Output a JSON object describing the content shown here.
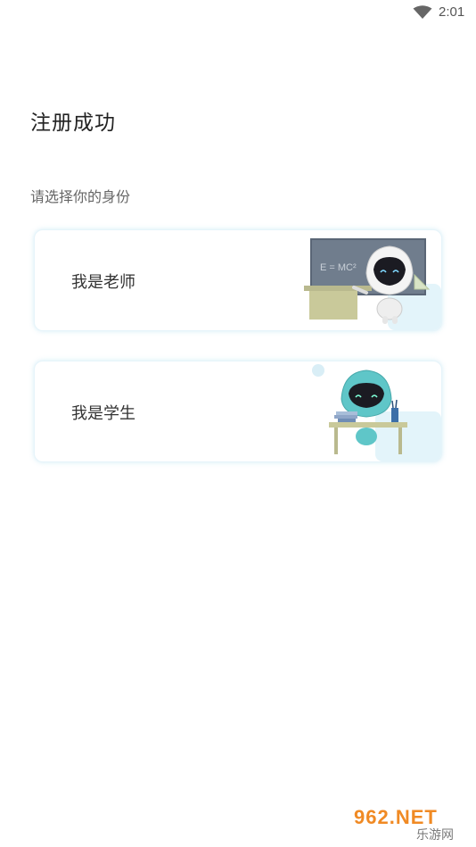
{
  "status_bar": {
    "time": "2:01",
    "wifi_icon": "wifi-icon"
  },
  "header": {
    "title": "注册成功"
  },
  "prompt": {
    "text": "请选择你的身份"
  },
  "roles": [
    {
      "label": "我是老师",
      "illustration": "teacher-robot-icon",
      "board_text": "E = MC²"
    },
    {
      "label": "我是学生",
      "illustration": "student-robot-icon"
    }
  ],
  "watermark": {
    "brand": "962.NET",
    "subtitle": "乐游网"
  },
  "colors": {
    "card_border": "#e6f4fa",
    "accent_cyan": "#5fc6c8",
    "board": "#6f7c8c"
  }
}
